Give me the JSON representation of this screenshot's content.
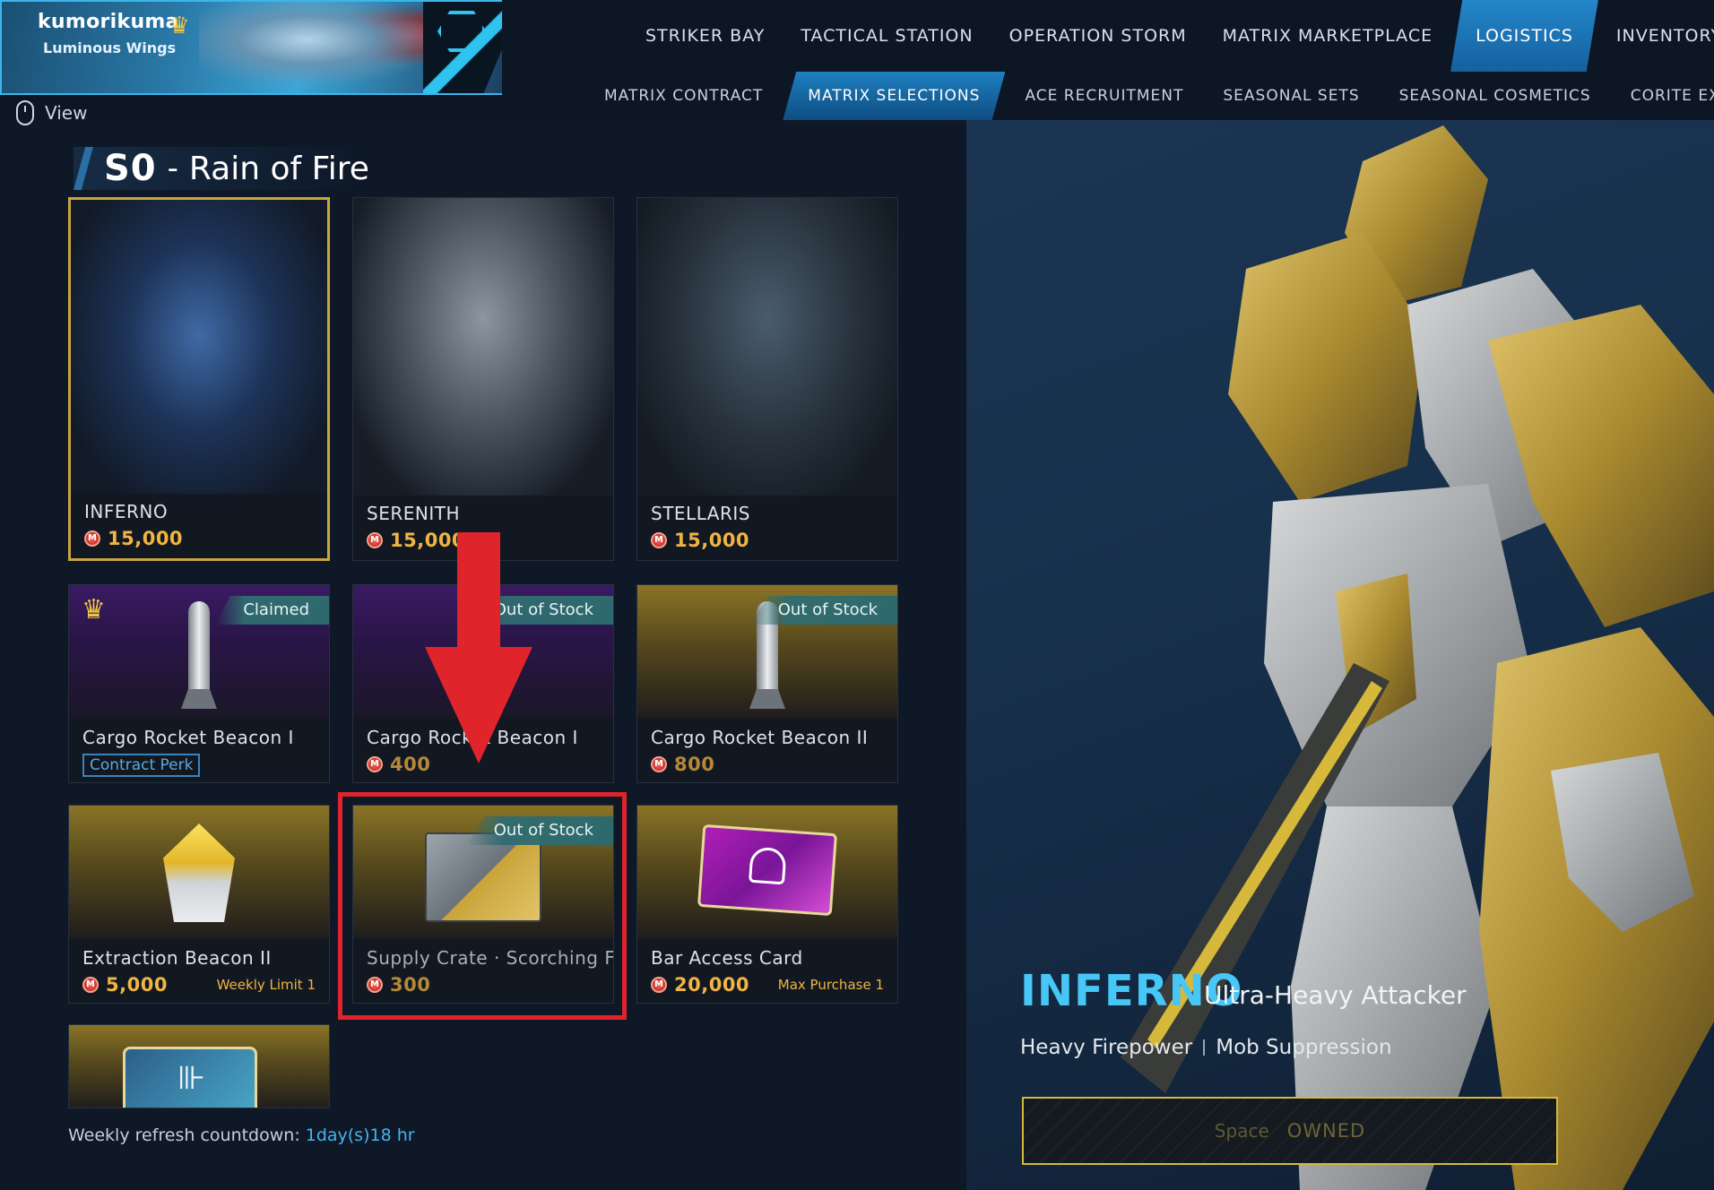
{
  "profile": {
    "name": "kumorikuma",
    "subtitle": "Luminous Wings",
    "rank_icon": "rank-emblem-icon"
  },
  "main_nav": [
    {
      "label": "STRIKER BAY",
      "active": false
    },
    {
      "label": "TACTICAL STATION",
      "active": false
    },
    {
      "label": "OPERATION STORM",
      "active": false
    },
    {
      "label": "MATRIX MARKETPLACE",
      "active": false
    },
    {
      "label": "LOGISTICS",
      "active": true
    },
    {
      "label": "INVENTORY",
      "active": false
    }
  ],
  "sub_nav": [
    {
      "label": "MATRIX CONTRACT",
      "active": false
    },
    {
      "label": "MATRIX SELECTIONS",
      "active": true
    },
    {
      "label": "ACE RECRUITMENT",
      "active": false
    },
    {
      "label": "SEASONAL SETS",
      "active": false
    },
    {
      "label": "SEASONAL COSMETICS",
      "active": false
    },
    {
      "label": "CORITE EXCHANGE",
      "active": false
    }
  ],
  "view_label": "View",
  "season": {
    "code": "S0",
    "separator": "-",
    "name": "Rain of Fire"
  },
  "mechs": [
    {
      "name": "INFERNO",
      "price": "15,000",
      "selected": true
    },
    {
      "name": "SERENITH",
      "price": "15,000",
      "selected": false
    },
    {
      "name": "STELLARIS",
      "price": "15,000",
      "selected": false
    }
  ],
  "items": [
    {
      "name": "Cargo Rocket Beacon I",
      "badge": "Claimed",
      "perk": "Contract Perk"
    },
    {
      "name": "Cargo Rocket Beacon I",
      "badge": "Out of Stock",
      "price": "400"
    },
    {
      "name": "Cargo Rocket Beacon II",
      "badge": "Out of Stock",
      "price": "800"
    },
    {
      "name": "Extraction Beacon II",
      "price": "5,000",
      "limit": "Weekly Limit 1"
    },
    {
      "name": "Supply Crate · Scorching Fire",
      "badge": "Out of Stock",
      "price": "300"
    },
    {
      "name": "Bar Access Card",
      "price": "20,000",
      "limit": "Max Purchase 1"
    }
  ],
  "refresh": {
    "label": "Weekly refresh countdown:",
    "time": "1day(s)18 hr"
  },
  "detail": {
    "name": "INFERNO",
    "class": "Ultra-Heavy Attacker",
    "traits": [
      "Heavy Firepower",
      "Mob Suppression"
    ],
    "key_hint": "Space",
    "status": "OWNED"
  },
  "colors": {
    "accent": "#47c7f5",
    "price": "#f1b440",
    "highlight": "#e0242c",
    "selected_border": "#c9a540"
  }
}
